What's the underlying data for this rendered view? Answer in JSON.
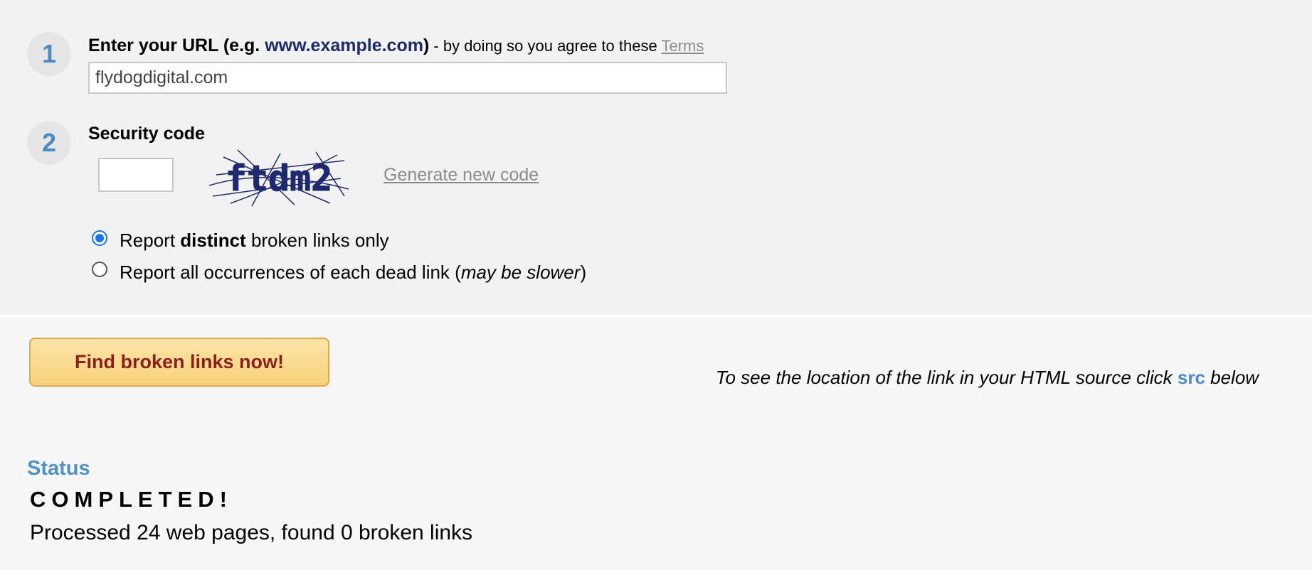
{
  "step1": {
    "number": "1",
    "label_prefix": "Enter your URL (e.g. ",
    "example_url": "www.example.com",
    "label_suffix": ")",
    "terms_note": " - by doing so you agree to these ",
    "terms_link": "Terms",
    "url_value": "flydogdigital.com"
  },
  "step2": {
    "number": "2",
    "label": "Security code",
    "code_value": "",
    "captcha_text": "ftdm2",
    "generate_link": "Generate new code"
  },
  "options": {
    "distinct": {
      "before": "Report ",
      "bold": "distinct",
      "after": " broken links only",
      "checked": true
    },
    "all": {
      "before": "Report all occurrences of each dead link (",
      "italic": "may be slower",
      "after": ")",
      "checked": false
    }
  },
  "action": {
    "button_label": "Find broken links now!"
  },
  "hint": {
    "before": "To see the location of the link in your HTML source click ",
    "src": "src",
    "after": " below"
  },
  "status": {
    "heading": "Status",
    "value": "COMPLETED!",
    "detail": "Processed 24 web pages, found 0 broken links"
  },
  "colors": {
    "accent": "#4d8bc4",
    "button_text": "#8b1f1b",
    "button_bg": "#f6d27c",
    "radio_checked": "#1a73e8"
  }
}
